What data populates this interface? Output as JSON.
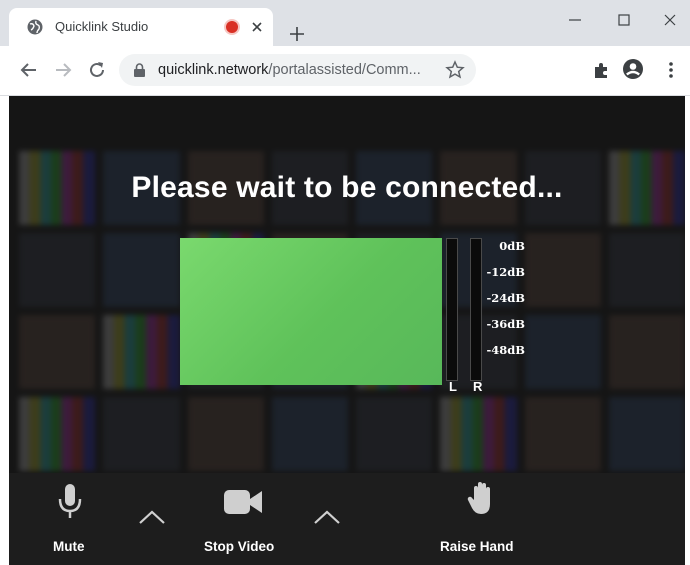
{
  "browser": {
    "tab_title": "Quicklink Studio",
    "url_host": "quicklink.network",
    "url_path": "/portalassisted/Comm..."
  },
  "page": {
    "heading": "Please wait to be connected...",
    "meter": {
      "channels": [
        "L",
        "R"
      ],
      "scale": [
        "0dB",
        "-12dB",
        "-24dB",
        "-36dB",
        "-48dB"
      ]
    },
    "controls": {
      "mute_label": "Mute",
      "stop_video_label": "Stop Video",
      "raise_hand_label": "Raise Hand"
    }
  },
  "colors": {
    "preview_green": "#6acd63",
    "recording_red": "#d93025",
    "stage_background": "#151515",
    "control_bar": "#1d1d1d"
  },
  "icons": {
    "favicon": "globe-icon",
    "recording": "recording-dot-icon",
    "extensions": "puzzle-icon",
    "profile": "account-icon"
  }
}
